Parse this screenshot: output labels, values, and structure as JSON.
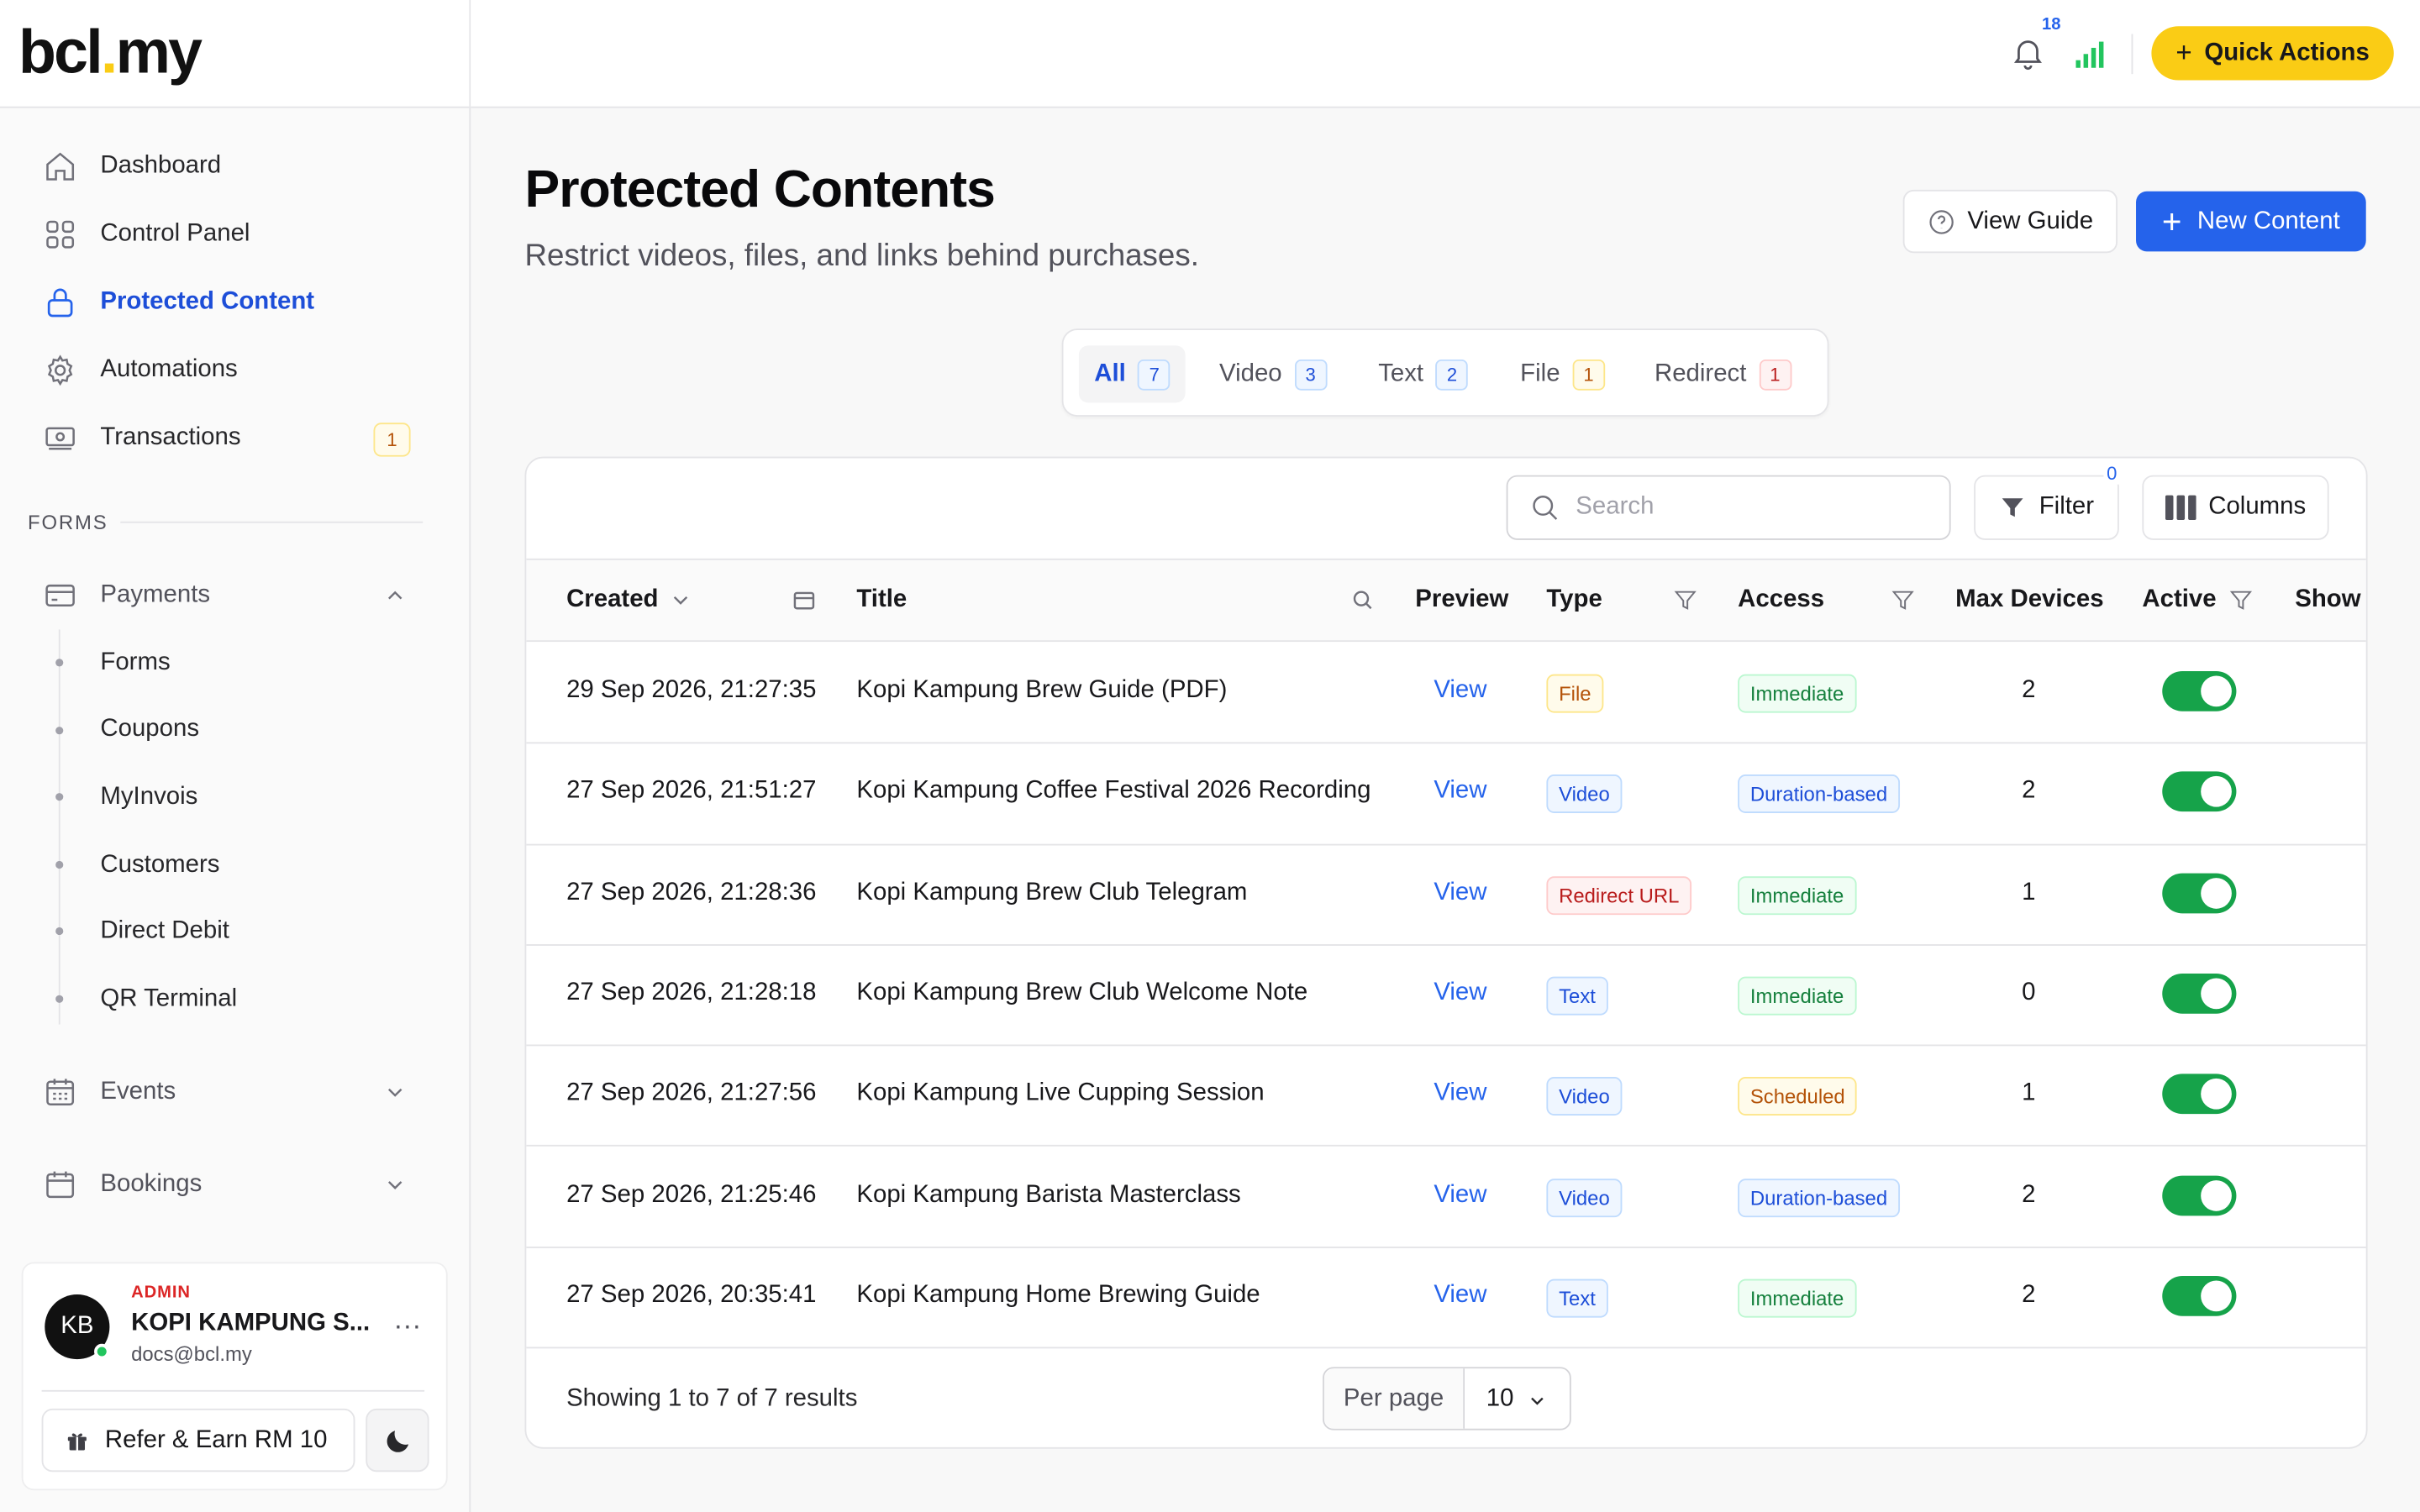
{
  "brand": {
    "logo_left": "bcl",
    "logo_dot": ".",
    "logo_right": "my"
  },
  "sidebar": {
    "items": [
      {
        "label": "Dashboard",
        "icon": "home-icon"
      },
      {
        "label": "Control Panel",
        "icon": "grid-icon"
      },
      {
        "label": "Protected Content",
        "icon": "lock-icon",
        "active": true
      },
      {
        "label": "Automations",
        "icon": "gear-icon"
      },
      {
        "label": "Transactions",
        "icon": "cash-icon",
        "badge": "1"
      }
    ],
    "forms_heading": "FORMS",
    "payments": {
      "label": "Payments",
      "sub": [
        "Forms",
        "Coupons",
        "MyInvois",
        "Customers",
        "Direct Debit",
        "QR Terminal"
      ]
    },
    "events": {
      "label": "Events"
    },
    "bookings": {
      "label": "Bookings"
    }
  },
  "user": {
    "initials": "KB",
    "role": "ADMIN",
    "name": "KOPI KAMPUNG S...",
    "email": "docs@bcl.my",
    "more": "···",
    "refer_label": "Refer & Earn RM 10"
  },
  "topbar": {
    "notifications": "18",
    "quick_actions": "Quick Actions"
  },
  "page": {
    "title": "Protected Contents",
    "subtitle": "Restrict videos, files, and links behind purchases.",
    "view_guide": "View Guide",
    "new_content": "New Content"
  },
  "tabs": [
    {
      "label": "All",
      "count": "7",
      "tone": "blue",
      "active": true
    },
    {
      "label": "Video",
      "count": "3",
      "tone": "blue"
    },
    {
      "label": "Text",
      "count": "2",
      "tone": "blue"
    },
    {
      "label": "File",
      "count": "1",
      "tone": "amber"
    },
    {
      "label": "Redirect",
      "count": "1",
      "tone": "red"
    }
  ],
  "toolbar": {
    "search_placeholder": "Search",
    "filter": "Filter",
    "filter_count": "0",
    "columns": "Columns"
  },
  "table": {
    "headers": {
      "created": "Created",
      "title": "Title",
      "preview": "Preview",
      "type": "Type",
      "access": "Access",
      "max_devices": "Max Devices",
      "active": "Active",
      "show": "Show"
    },
    "rows": [
      {
        "created": "29 Sep 2026, 21:27:35",
        "title": "Kopi Kampung Brew Guide (PDF)",
        "preview": "View",
        "type": "File",
        "type_tone": "amber",
        "access": "Immediate",
        "access_tone": "green",
        "max_devices": "2",
        "active": true
      },
      {
        "created": "27 Sep 2026, 21:51:27",
        "title": "Kopi Kampung Coffee Festival 2026 Recording",
        "preview": "View",
        "type": "Video",
        "type_tone": "blue",
        "access": "Duration-based",
        "access_tone": "blue",
        "max_devices": "2",
        "active": true
      },
      {
        "created": "27 Sep 2026, 21:28:36",
        "title": "Kopi Kampung Brew Club Telegram",
        "preview": "View",
        "type": "Redirect URL",
        "type_tone": "red",
        "access": "Immediate",
        "access_tone": "green",
        "max_devices": "1",
        "active": true
      },
      {
        "created": "27 Sep 2026, 21:28:18",
        "title": "Kopi Kampung Brew Club Welcome Note",
        "preview": "View",
        "type": "Text",
        "type_tone": "blue",
        "access": "Immediate",
        "access_tone": "green",
        "max_devices": "0",
        "active": true
      },
      {
        "created": "27 Sep 2026, 21:27:56",
        "title": "Kopi Kampung Live Cupping Session",
        "preview": "View",
        "type": "Video",
        "type_tone": "blue",
        "access": "Scheduled",
        "access_tone": "amber",
        "max_devices": "1",
        "active": true
      },
      {
        "created": "27 Sep 2026, 21:25:46",
        "title": "Kopi Kampung Barista Masterclass",
        "preview": "View",
        "type": "Video",
        "type_tone": "blue",
        "access": "Duration-based",
        "access_tone": "blue",
        "max_devices": "2",
        "active": true
      },
      {
        "created": "27 Sep 2026, 20:35:41",
        "title": "Kopi Kampung Home Brewing Guide",
        "preview": "View",
        "type": "Text",
        "type_tone": "blue",
        "access": "Immediate",
        "access_tone": "green",
        "max_devices": "2",
        "active": true
      }
    ]
  },
  "footer": {
    "showing": "Showing 1 to 7 of 7 results",
    "per_page_label": "Per page",
    "per_page_value": "10"
  },
  "colors": {
    "primary": "#2563eb",
    "accent_yellow": "#facc15",
    "toggle_on": "#16a34a"
  }
}
